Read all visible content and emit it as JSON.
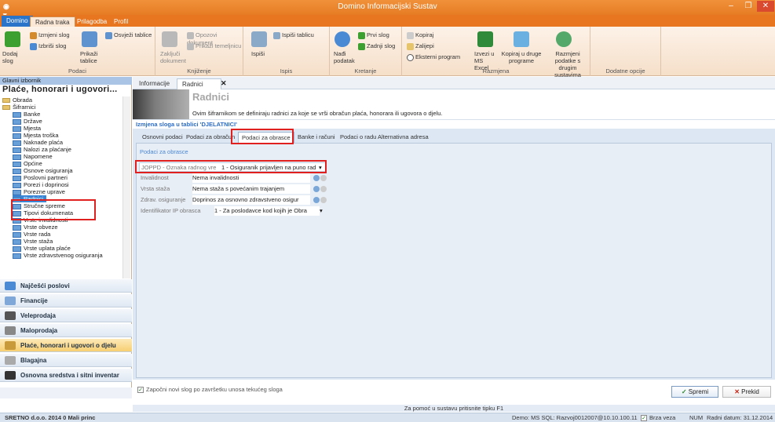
{
  "window": {
    "title": "Domino Informacijski Sustav"
  },
  "menu": {
    "tabs": [
      "Domino",
      "Radna traka",
      "Prilagodba",
      "Profil"
    ]
  },
  "ribbon": {
    "podaci": {
      "label": "Podaci",
      "dodaj": "Dodaj slog",
      "izmjeni": "Izmjeni slog",
      "izbrisi": "Izbriši slog",
      "osvjezi": "Osvježi tablice",
      "prikazi": "Prikaži tablice"
    },
    "knjizenje": {
      "label": "Knjiženje",
      "zakljuci": "Zaključi dokument",
      "opozovi": "Opozovi dokument",
      "temeljnica": "Prikaži temeljnicu"
    },
    "ispis": {
      "label": "Ispis",
      "ispisi": "Ispiši",
      "tablicu": "Ispiši tablicu"
    },
    "kretanje": {
      "label": "Kretanje",
      "nadi": "Nađi podatak",
      "prvi": "Prvi slog",
      "zadnji": "Zadnji slog"
    },
    "razmjena": {
      "label": "Razmjena",
      "kopiraj": "Kopiraj",
      "zalijepi": "Zalijepi",
      "eksterni": "Eksterni program",
      "excel": "Izvezi u MS Excel",
      "druge": "Kopiraj u druge programe",
      "razmjeni": "Razmjeni podatke s drugim sustavima"
    },
    "dodatne": {
      "label": "Dodatne opcije"
    }
  },
  "leftpanel": {
    "header": "Glavni izbornik",
    "title": "Plaće, honorari i ugovori...",
    "tree": [
      "Obrada",
      "Šifrarnici",
      "Banke",
      "Države",
      "Mjesta",
      "Mjesta troška",
      "Naknade plaća",
      "Nalozi za plaćanje",
      "Napomene",
      "Općine",
      "Osnove osiguranja",
      "Poslovni partneri",
      "Porezi i doprinosi",
      "Porezne uprave",
      "Radnici",
      "Stručne spreme",
      "Tipovi dokumenata",
      "Vrste invalidnosti",
      "Vrste obveze",
      "Vrste rada",
      "Vrste staža",
      "Vrste uplata plaće",
      "Vrste zdravstvenog osiguranja"
    ],
    "nav": [
      "Najčešći poslovi",
      "Financije",
      "Veleprodaja",
      "Maloprodaja",
      "Plaće, honorari i ugovori o djelu",
      "Blagajna",
      "Osnovna sredstva i sitni inventar"
    ]
  },
  "main": {
    "tabs": [
      "Informacije",
      "Radnici"
    ],
    "title": "Radnici",
    "description": "Ovim šifrarnikom se definiraju radnici za koje se vrši obračun plaća, honorara ili ugovora o djelu.",
    "subheader": "Izmjena sloga u tablici 'DJELATNICI'",
    "inner_tabs": [
      "Osnovni podaci",
      "Podaci za obračun",
      "Podaci za obrasce",
      "Banke i računi",
      "Podaci o radu",
      "Alternativna adresa"
    ],
    "section": "Podaci za obrasce",
    "fields": [
      {
        "label": "JOPPD - Oznaka radnog vre",
        "value": "1 - Osiguranik prijavljen na puno rad"
      },
      {
        "label": "Invalidnost",
        "value": "Nema invalidnosti"
      },
      {
        "label": "Vrsta staža",
        "value": "Nema staža s povećanim trajanjem"
      },
      {
        "label": "Zdrav. osiguranje",
        "value": "Doprinos za osnovno zdravstveno osigur"
      },
      {
        "label": "Identifikator IP obrasca",
        "value": "1 - Za poslodavce kod kojih je Obra"
      }
    ],
    "checkbox": "Započni novi slog po završetku unosa tekućeg sloga",
    "save": "Spremi",
    "cancel": "Prekid"
  },
  "hint": "Za pomoć u sustavu pritisnite tipku F1",
  "status": {
    "left": "SRETNO d.o.o. 2014 0 Mali princ",
    "db": "Demo: MS SQL: Razvoj0012007@10.10.100.11",
    "brza": "Brza veza",
    "num": "NUM",
    "date": "Radni datum: 31.12.2014"
  },
  "colors": {
    "accent": "#e8751f",
    "highlight": "#e0201e",
    "link": "#2b6cc4"
  }
}
